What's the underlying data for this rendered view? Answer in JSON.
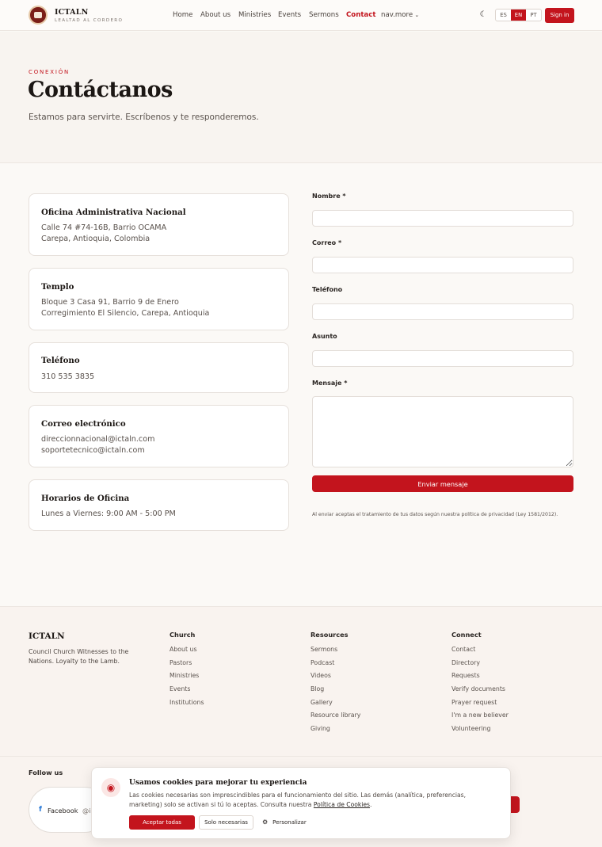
{
  "header": {
    "brand_name": "ICTALN",
    "brand_tagline": "LEALTAD AL CORDERO",
    "nav": [
      "Home",
      "About us",
      "Ministries",
      "Events",
      "Sermons",
      "Contact",
      "nav.more"
    ],
    "active_nav": "Contact",
    "theme_icon": "moon-icon",
    "languages": [
      "ES",
      "EN",
      "PT"
    ],
    "selected_language": "EN",
    "sign_in": "Sign in"
  },
  "hero": {
    "eyebrow": "CONEXIÓN",
    "title": "Contáctanos",
    "subtitle": "Estamos para servirte. Escríbenos y te responderemos."
  },
  "info_cards": [
    {
      "title": "Oficina Administrativa Nacional",
      "lines": [
        "Calle 74 #74-16B, Barrio OCAMA",
        "Carepa, Antioquia, Colombia"
      ]
    },
    {
      "title": "Templo",
      "lines": [
        "Bloque 3 Casa 91, Barrio 9 de Enero",
        "Corregimiento El Silencio, Carepa, Antioquia"
      ]
    },
    {
      "title": "Teléfono",
      "lines": [
        "310 535 3835"
      ]
    },
    {
      "title": "Correo electrónico",
      "lines": [
        "direccionnacional@ictaln.com",
        "soportetecnico@ictaln.com"
      ]
    },
    {
      "title": "Horarios de Oficina",
      "lines": [
        "Lunes a Viernes: 9:00 AM - 5:00 PM"
      ]
    }
  ],
  "form": {
    "name_label": "Nombre *",
    "email_label": "Correo *",
    "phone_label": "Teléfono",
    "subject_label": "Asunto",
    "message_label": "Mensaje *",
    "name_value": "",
    "email_value": "",
    "phone_value": "",
    "subject_value": "",
    "message_value": "",
    "submit": "Enviar mensaje",
    "privacy_note": "Al enviar aceptas el tratamiento de tus datos según nuestra política de privacidad (Ley 1581/2012)."
  },
  "footer": {
    "brand": "ICTALN",
    "description": "Council Church Witnesses to the Nations. Loyalty to the Lamb.",
    "columns": [
      {
        "heading": "Church",
        "links": [
          "About us",
          "Pastors",
          "Ministries",
          "Events",
          "Institutions"
        ]
      },
      {
        "heading": "Resources",
        "links": [
          "Sermons",
          "Podcast",
          "Videos",
          "Blog",
          "Gallery",
          "Resource library",
          "Giving"
        ]
      },
      {
        "heading": "Connect",
        "links": [
          "Contact",
          "Directory",
          "Requests",
          "Verify documents",
          "Prayer request",
          "I'm a new believer",
          "Volunteering"
        ]
      }
    ],
    "follow_heading": "Follow us",
    "social": {
      "icon": "facebook-icon",
      "label": "Facebook",
      "handle": "@i"
    }
  },
  "cookie_banner": {
    "icon": "cookie-icon",
    "title": "Usamos cookies para mejorar tu experiencia",
    "text": "Las cookies necesarias son imprescindibles para el funcionamiento del sitio. Las demás (analítica, preferencias, marketing) solo se activan si tú lo aceptas. Consulta nuestra ",
    "policy_link": "Política de Cookies",
    "text_end": ".",
    "accept_all": "Aceptar todas",
    "only_necessary": "Solo necesarias",
    "customize": "Personalizar",
    "customize_icon": "sliders-icon"
  },
  "colors": {
    "accent": "#c3141d",
    "background": "#fbf9f6",
    "hero_background": "#f8f4f0",
    "footer_background": "#f9f3ef"
  }
}
